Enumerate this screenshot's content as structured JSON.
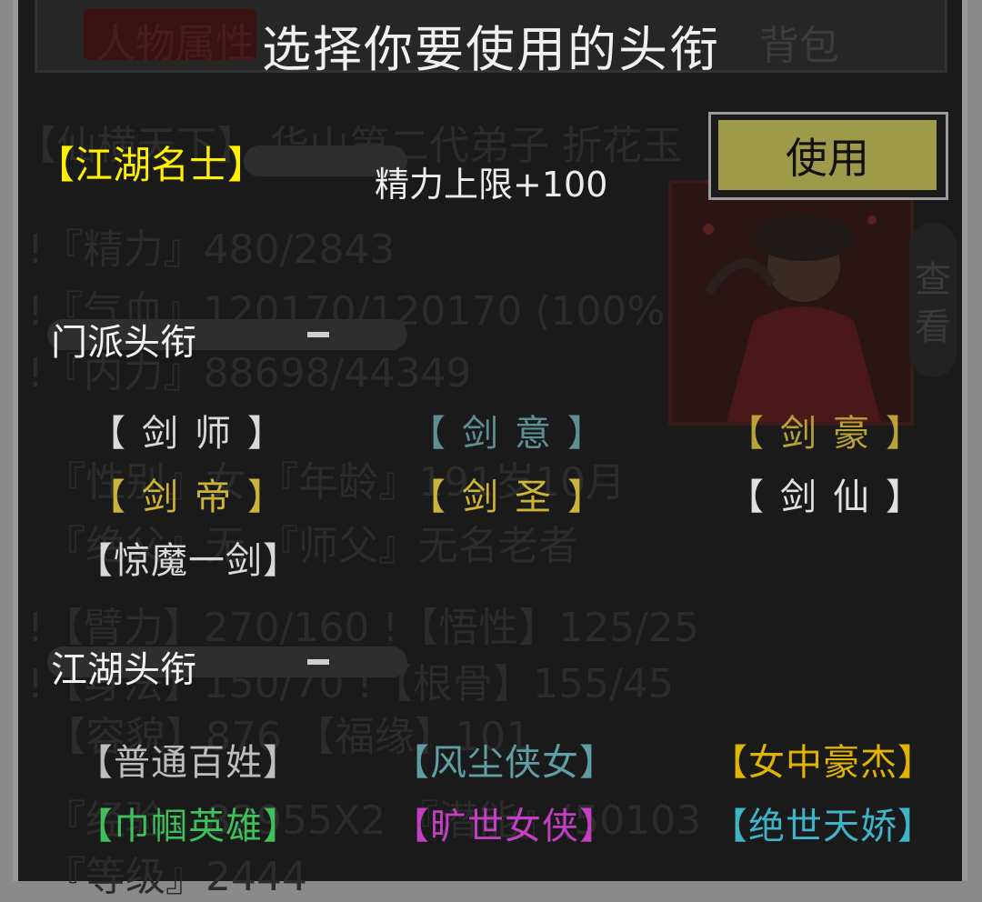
{
  "header": {
    "title": "选择你要使用的头衔"
  },
  "background": {
    "tab_left": "人物属性",
    "tab_right": "背包",
    "lines": [
      "【仙横天下】  华山第二代弟子 折花玉",
      "!『精力』480/2843",
      "!『气血』120170/120170 (100%)",
      "!『内力』88698/44349",
      "『性别』女  『年龄』191岁10月",
      "『绝父』无       『师父』无名老者",
      "!【臂力】270/160      !【悟性】125/25",
      "!【身法】150/70       !【根骨】155/45",
      "【容貌】876          【福缘】101",
      "『经验』82955X2      『潜能』(50103",
      "『等级』2444"
    ],
    "side_button": "查看"
  },
  "current": {
    "title": "【江湖名士】",
    "effect": "精力上限+100",
    "use_button": "使用"
  },
  "sections": [
    {
      "label": "门派头衔",
      "toggle": "—",
      "items": [
        {
          "text": "【剑师】",
          "color": "#d9d9d9"
        },
        {
          "text": "【剑意】",
          "color": "#5f8f93"
        },
        {
          "text": "【剑豪】",
          "color": "#b9a236"
        },
        {
          "text": "【剑帝】",
          "color": "#cbb437"
        },
        {
          "text": "【剑圣】",
          "color": "#cbb437"
        },
        {
          "text": "【剑仙】",
          "color": "#e0e0e0"
        },
        {
          "text": "【惊魔一剑】",
          "color": "#d9d9d9"
        }
      ]
    },
    {
      "label": "江湖头衔",
      "toggle": "—",
      "items": [
        {
          "text": "【普通百姓】",
          "color": "#bdbdbd"
        },
        {
          "text": "【风尘侠女】",
          "color": "#5f9ea3"
        },
        {
          "text": "【女中豪杰】",
          "color": "#e0b400"
        },
        {
          "text": "【巾帼英雄】",
          "color": "#3fbf5a"
        },
        {
          "text": "【旷世女侠】",
          "color": "#c23fc2"
        },
        {
          "text": "【绝世天娇】",
          "color": "#3fb4c8"
        }
      ]
    }
  ]
}
